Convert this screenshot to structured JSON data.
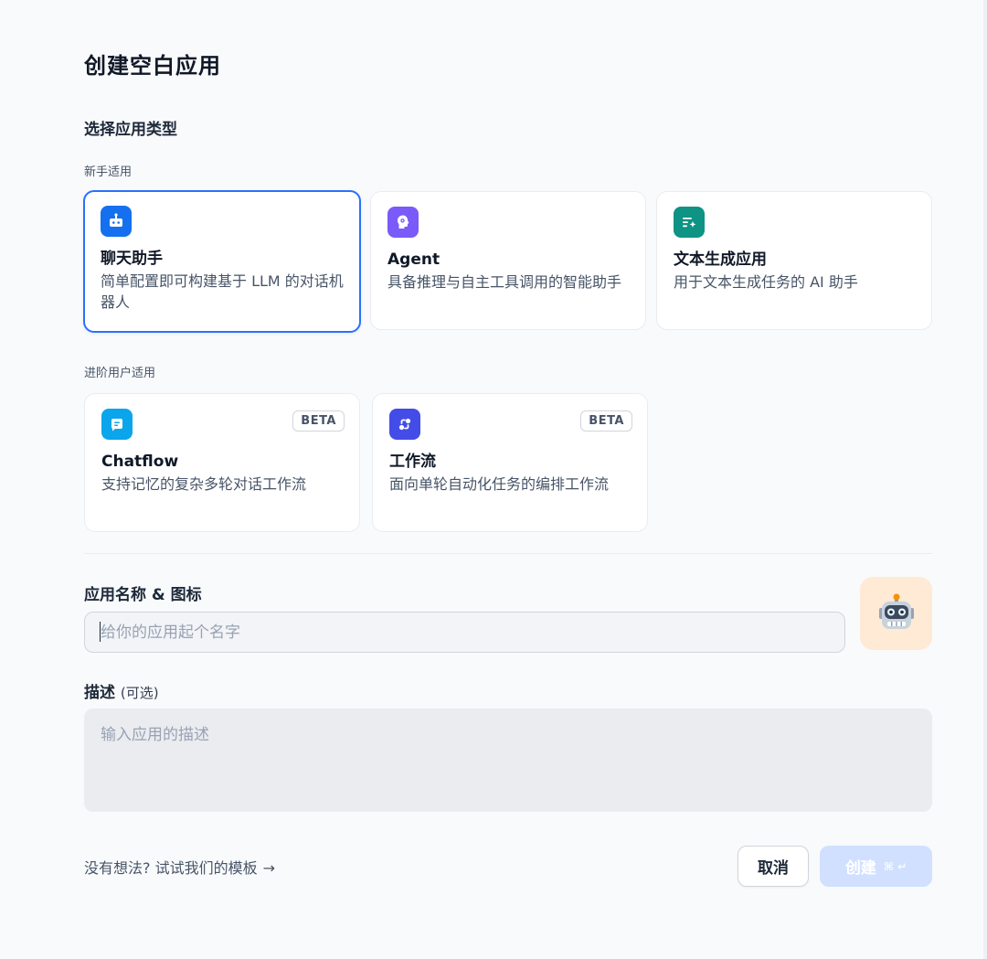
{
  "dialog": {
    "title": "创建空白应用"
  },
  "app_type": {
    "section_title": "选择应用类型",
    "beginner_label": "新手适用",
    "advanced_label": "进阶用户适用",
    "beginner": [
      {
        "title": "聊天助手",
        "desc": "简单配置即可构建基于 LLM 的对话机器人",
        "icon": "chat-bot-icon",
        "color": "#1570ef",
        "selected": true
      },
      {
        "title": "Agent",
        "desc": "具备推理与自主工具调用的智能助手",
        "icon": "agent-head-icon",
        "color": "#7a5af8",
        "selected": false
      },
      {
        "title": "文本生成应用",
        "desc": "用于文本生成任务的 AI 助手",
        "icon": "text-generate-icon",
        "color": "#0e9384",
        "selected": false
      }
    ],
    "advanced": [
      {
        "title": "Chatflow",
        "desc": "支持记忆的复杂多轮对话工作流",
        "icon": "chatflow-icon",
        "color": "#0ba5ec",
        "badge": "BETA"
      },
      {
        "title": "工作流",
        "desc": "面向单轮自动化任务的编排工作流",
        "icon": "workflow-icon",
        "color": "#444ce7",
        "badge": "BETA"
      }
    ]
  },
  "name_field": {
    "label": "应用名称 & 图标",
    "placeholder": "给你的应用起个名字",
    "icon": "robot-emoji",
    "icon_glyph": "🤖",
    "icon_bg": "#ffead5"
  },
  "desc_field": {
    "label": "描述",
    "optional": "(可选)",
    "placeholder": "输入应用的描述"
  },
  "footer": {
    "template_link": "没有想法? 试试我们的模板",
    "template_arrow": "→",
    "cancel_label": "取消",
    "create_label": "创建",
    "create_shortcut": "⌘ ↵"
  },
  "colors": {
    "accent": "#2970ff",
    "create_disabled": "#d1e0ff"
  }
}
